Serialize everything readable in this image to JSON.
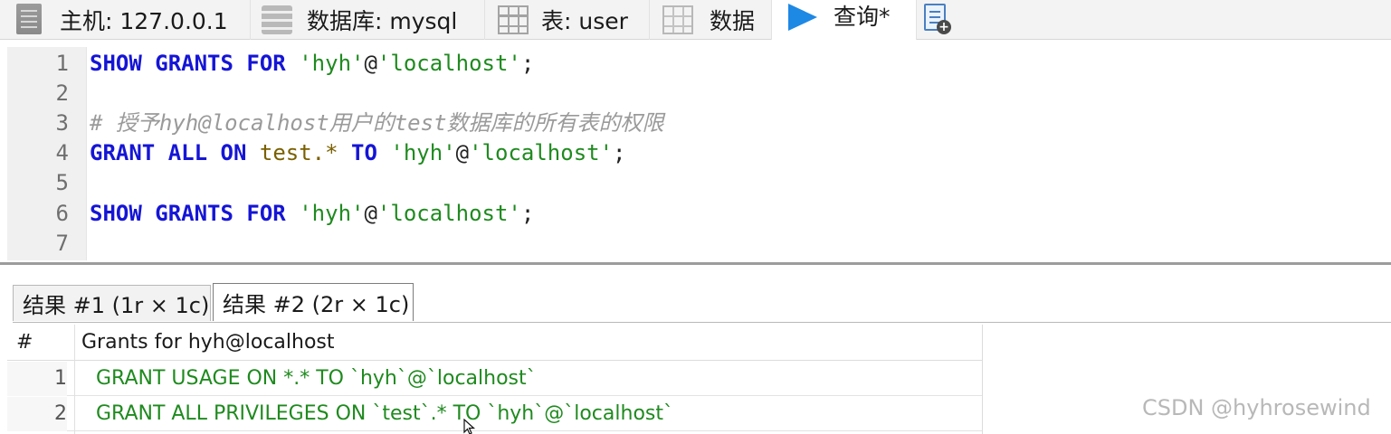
{
  "tabs": [
    {
      "icon": "server-icon",
      "label": "主机: 127.0.0.1"
    },
    {
      "icon": "database-icon",
      "label": "数据库: mysql"
    },
    {
      "icon": "table-icon",
      "label": "表: user"
    },
    {
      "icon": "data-grid-icon",
      "label": "数据"
    },
    {
      "icon": "play-icon",
      "label": "查询*",
      "active": true
    },
    {
      "icon": "new-query-icon",
      "label": ""
    }
  ],
  "editor": {
    "line_numbers": [
      "1",
      "2",
      "3",
      "4",
      "5",
      "6",
      "7"
    ],
    "line1": {
      "kw1": "SHOW",
      "kw2": "GRANTS",
      "kw3": "FOR",
      "s1": "'hyh'",
      "at": "@",
      "s2": "'localhost'",
      "end": ";"
    },
    "line3": {
      "comment": "# 授予hyh@localhost用户的test数据库的所有表的权限"
    },
    "line4": {
      "kw1": "GRANT",
      "kw2": "ALL",
      "kw3": "ON",
      "ident": "test.*",
      "kw4": "TO",
      "s1": "'hyh'",
      "at": "@",
      "s2": "'localhost'",
      "end": ";"
    },
    "line6": {
      "kw1": "SHOW",
      "kw2": "GRANTS",
      "kw3": "FOR",
      "s1": "'hyh'",
      "at": "@",
      "s2": "'localhost'",
      "end": ";"
    }
  },
  "result_tabs": [
    {
      "label": "结果 #1 (1r × 1c)"
    },
    {
      "label": "结果 #2 (2r × 1c)",
      "active": true
    }
  ],
  "grid": {
    "headers": [
      "#",
      "Grants for hyh@localhost"
    ],
    "rows": [
      {
        "num": "1",
        "value": "GRANT USAGE ON *.* TO `hyh`@`localhost`"
      },
      {
        "num": "2",
        "value": "GRANT ALL PRIVILEGES ON `test`.* TO `hyh`@`localhost`"
      }
    ]
  },
  "watermark": "CSDN @hyhrosewind",
  "colors": {
    "keyword": "#1515d6",
    "string": "#1f8a1f",
    "identifier": "#7a6000",
    "comment": "#9a9a9a",
    "play": "#1e88e5"
  }
}
